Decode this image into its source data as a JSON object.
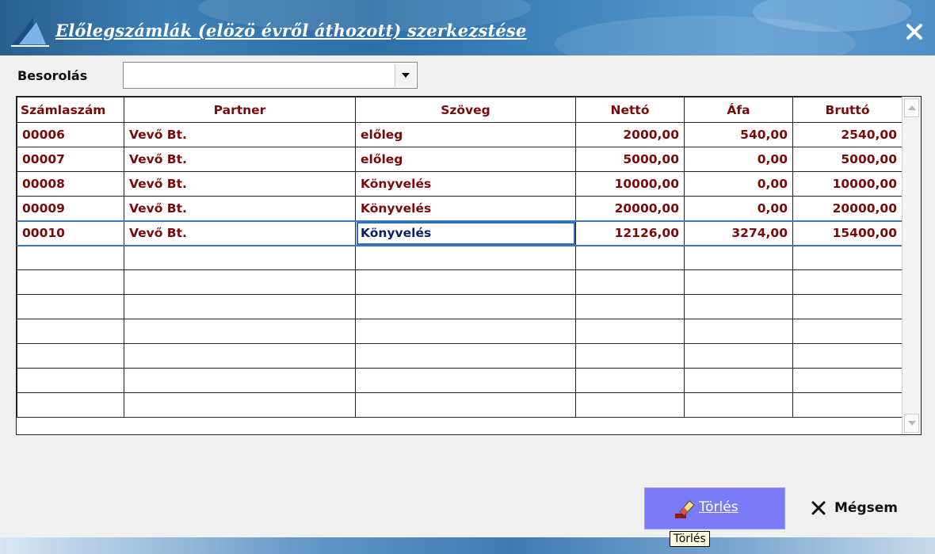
{
  "window": {
    "title": "Előlegszámlák (elözö évről áthozott) szerkezstése",
    "close_icon": "close-icon"
  },
  "filter": {
    "label": "Besorolás",
    "value": ""
  },
  "table": {
    "columns": [
      "Számlaszám",
      "Partner",
      "Szöveg",
      "Nettó",
      "Áfa",
      "Bruttó"
    ],
    "rows": [
      {
        "szamlaszam": "00006",
        "partner": "Vevő Bt.",
        "szoveg": "előleg",
        "netto": "2000,00",
        "afa": "540,00",
        "brutto": "2540,00"
      },
      {
        "szamlaszam": "00007",
        "partner": "Vevő Bt.",
        "szoveg": "előleg",
        "netto": "5000,00",
        "afa": "0,00",
        "brutto": "5000,00"
      },
      {
        "szamlaszam": "00008",
        "partner": "Vevő Bt.",
        "szoveg": "Könyvelés",
        "netto": "10000,00",
        "afa": "0,00",
        "brutto": "10000,00"
      },
      {
        "szamlaszam": "00009",
        "partner": "Vevő Bt.",
        "szoveg": "Könyvelés",
        "netto": "20000,00",
        "afa": "0,00",
        "brutto": "20000,00"
      },
      {
        "szamlaszam": "00010",
        "partner": "Vevő Bt.",
        "szoveg": "Könyvelés",
        "netto": "12126,00",
        "afa": "3274,00",
        "brutto": "15400,00"
      }
    ],
    "empty_rows": 7,
    "selected_row": 4
  },
  "buttons": {
    "delete_label": "Törlés",
    "cancel_label": "Mégsem"
  },
  "tooltip": {
    "text": "Törlés"
  },
  "colors": {
    "cell_text": "#7a0a0a",
    "delete_button_bg": "#7b7bf7",
    "selection": "#3a78c4"
  }
}
